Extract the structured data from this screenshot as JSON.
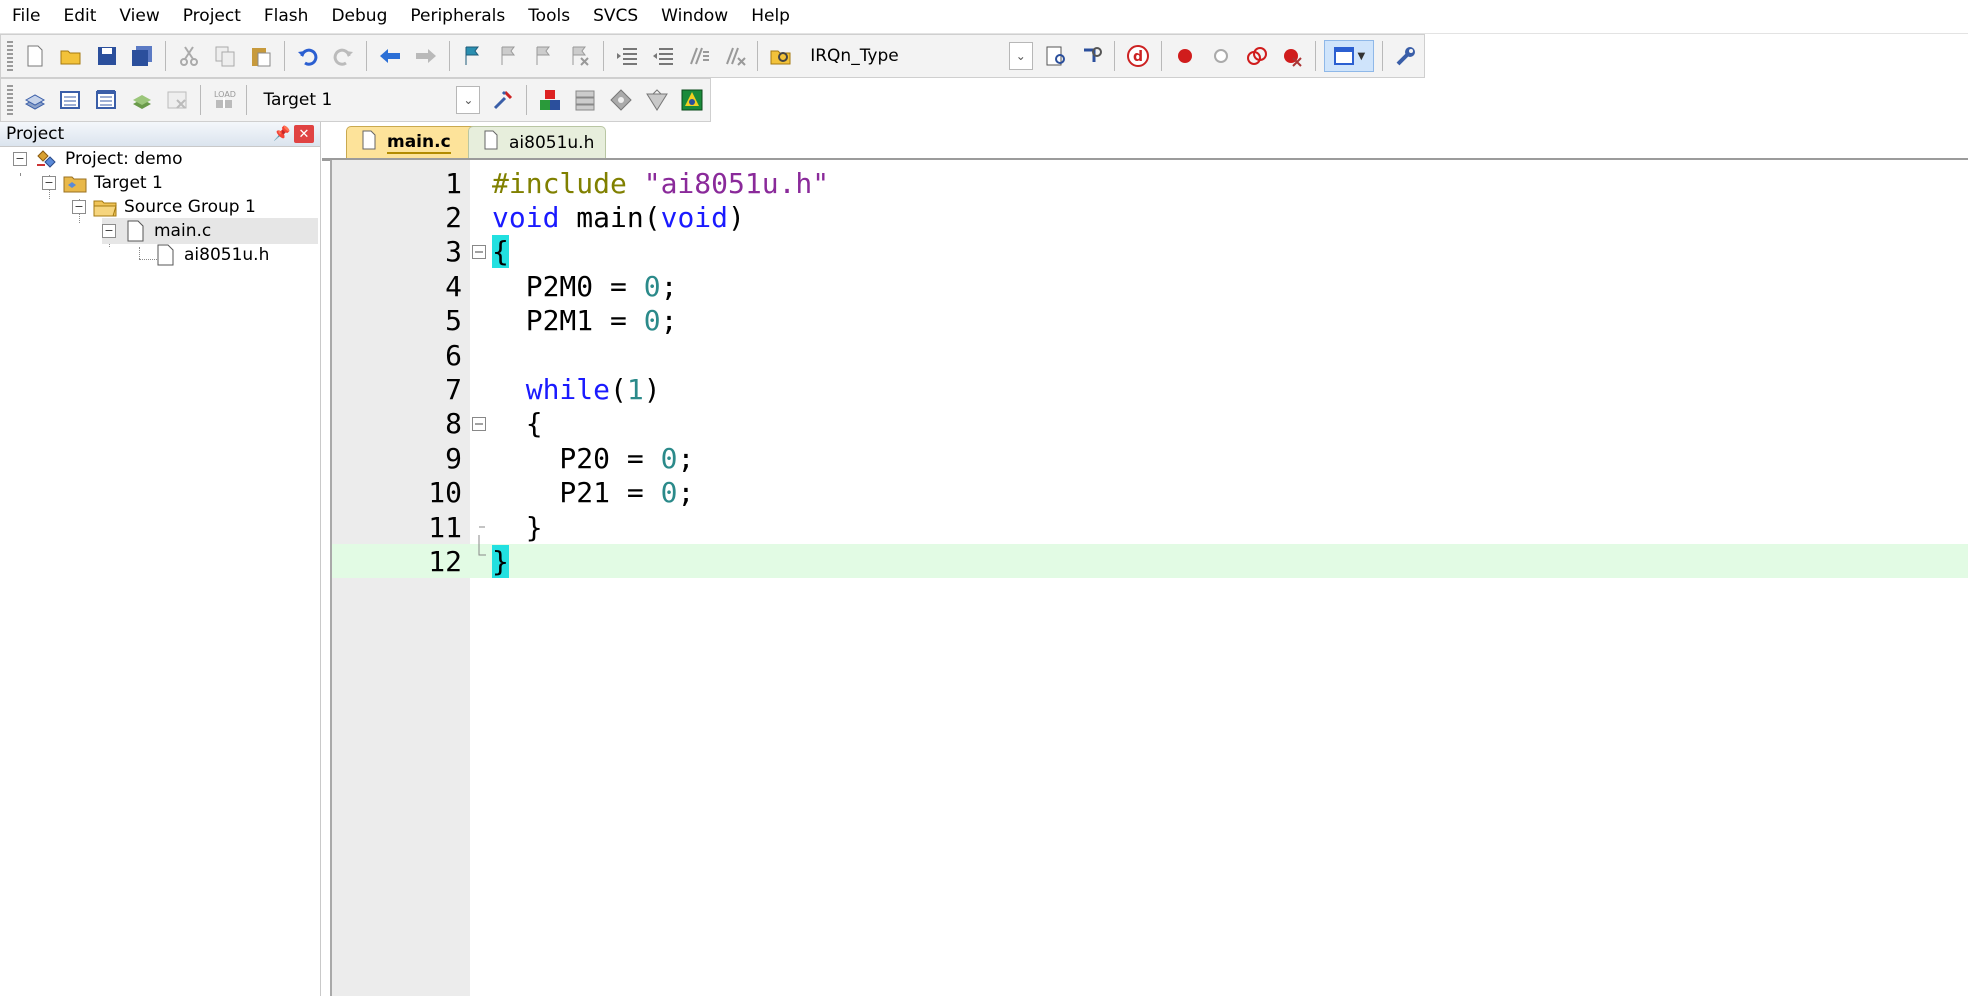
{
  "menu": [
    "File",
    "Edit",
    "View",
    "Project",
    "Flash",
    "Debug",
    "Peripherals",
    "Tools",
    "SVCS",
    "Window",
    "Help"
  ],
  "toolbar1": {
    "combo_value": "IRQn_Type"
  },
  "toolbar2": {
    "target_value": "Target 1",
    "load_label": "LOAD"
  },
  "project_panel": {
    "title": "Project",
    "tree": [
      {
        "label": "Project: demo",
        "level": 0,
        "icon": "project-icon"
      },
      {
        "label": "Target 1",
        "level": 1,
        "icon": "target-folder-icon"
      },
      {
        "label": "Source Group 1",
        "level": 2,
        "icon": "folder-icon"
      },
      {
        "label": "main.c",
        "level": 3,
        "icon": "file-icon",
        "selected": true
      },
      {
        "label": "ai8051u.h",
        "level": 4,
        "icon": "file-icon"
      }
    ]
  },
  "tabs": [
    {
      "label": "main.c",
      "active": true
    },
    {
      "label": "ai8051u.h",
      "active": false
    }
  ],
  "editor": {
    "current_line": 12,
    "lines": [
      {
        "n": "1",
        "tokens": [
          {
            "t": "#include ",
            "c": "pp"
          },
          {
            "t": "\"ai8051u.h\"",
            "c": "str"
          }
        ]
      },
      {
        "n": "2",
        "tokens": [
          {
            "t": "void",
            "c": "kw"
          },
          {
            "t": " main(",
            "c": ""
          },
          {
            "t": "void",
            "c": "kw"
          },
          {
            "t": ")",
            "c": ""
          }
        ]
      },
      {
        "n": "3",
        "fold": "open",
        "tokens": [
          {
            "t": "{",
            "c": "br"
          }
        ]
      },
      {
        "n": "4",
        "tokens": [
          {
            "t": "  P2M0 = ",
            "c": ""
          },
          {
            "t": "0",
            "c": "num"
          },
          {
            "t": ";",
            "c": ""
          }
        ]
      },
      {
        "n": "5",
        "tokens": [
          {
            "t": "  P2M1 = ",
            "c": ""
          },
          {
            "t": "0",
            "c": "num"
          },
          {
            "t": ";",
            "c": ""
          }
        ]
      },
      {
        "n": "6",
        "tokens": []
      },
      {
        "n": "7",
        "tokens": [
          {
            "t": "  ",
            "c": ""
          },
          {
            "t": "while",
            "c": "kw"
          },
          {
            "t": "(",
            "c": ""
          },
          {
            "t": "1",
            "c": "num"
          },
          {
            "t": ")",
            "c": ""
          }
        ]
      },
      {
        "n": "8",
        "fold": "open",
        "tokens": [
          {
            "t": "  {",
            "c": ""
          }
        ]
      },
      {
        "n": "9",
        "tokens": [
          {
            "t": "    P20 = ",
            "c": ""
          },
          {
            "t": "0",
            "c": "num"
          },
          {
            "t": ";",
            "c": ""
          }
        ]
      },
      {
        "n": "10",
        "tokens": [
          {
            "t": "    P21 = ",
            "c": ""
          },
          {
            "t": "0",
            "c": "num"
          },
          {
            "t": ";",
            "c": ""
          }
        ]
      },
      {
        "n": "11",
        "fold": "end",
        "tokens": [
          {
            "t": "  }",
            "c": ""
          }
        ]
      },
      {
        "n": "12",
        "fold": "last",
        "tokens": [
          {
            "t": "}",
            "c": "br"
          }
        ]
      }
    ]
  }
}
